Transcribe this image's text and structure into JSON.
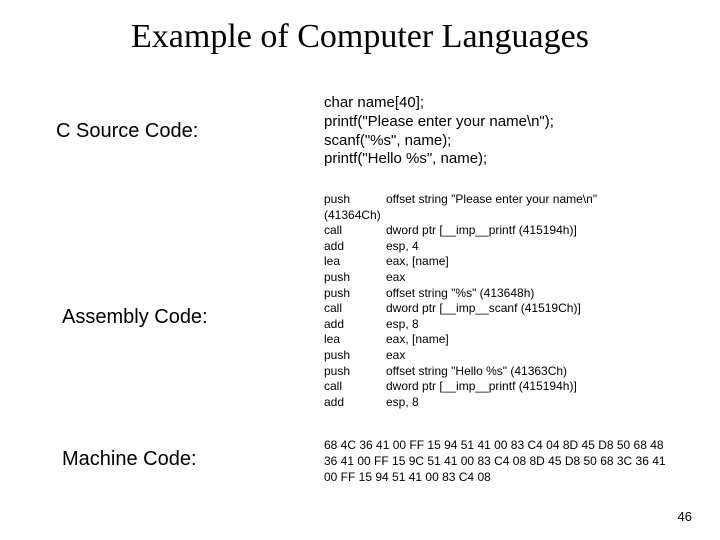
{
  "title": "Example of Computer Languages",
  "page_number": "46",
  "labels": {
    "c": "C Source Code:",
    "asm": "Assembly Code:",
    "mc": "Machine Code:"
  },
  "c_code": "char name[40];\nprintf(\"Please enter your name\\n\");\nscanf(\"%s\", name);\nprintf(\"Hello %s\", name);",
  "asm_code": [
    {
      "op": "push",
      "arg": "offset string \"Please enter your name\\n\""
    },
    {
      "full": "(41364Ch)"
    },
    {
      "op": "call",
      "arg": "dword ptr [__imp__printf (415194h)]"
    },
    {
      "op": "add",
      "arg": "esp, 4"
    },
    {
      "op": "lea",
      "arg": "eax, [name]"
    },
    {
      "op": "push",
      "arg": "eax"
    },
    {
      "op": "push",
      "arg": "offset string \"%s\" (413648h)"
    },
    {
      "op": "call",
      "arg": "dword ptr [__imp__scanf (41519Ch)]"
    },
    {
      "op": "add",
      "arg": "esp, 8"
    },
    {
      "op": "lea",
      "arg": "eax, [name]"
    },
    {
      "op": "push",
      "arg": "eax"
    },
    {
      "op": "push",
      "arg": "offset string \"Hello %s\" (41363Ch)"
    },
    {
      "op": "call",
      "arg": "dword ptr [__imp__printf (415194h)]"
    },
    {
      "op": "add",
      "arg": "esp, 8"
    }
  ],
  "machine_code": "68 4C 36 41 00 FF 15 94 51 41 00 83 C4 04 8D 45 D8 50 68 48 36 41 00 FF 15 9C 51 41 00 83 C4 08 8D 45 D8 50 68 3C 36 41 00 FF 15 94 51 41 00 83 C4 08"
}
